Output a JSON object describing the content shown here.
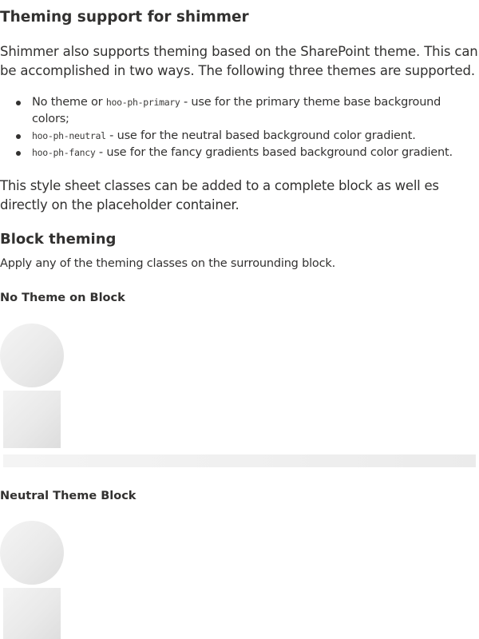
{
  "section": {
    "title": "Theming support for shimmer",
    "intro": "Shimmer also supports theming based on the SharePoint theme. This can be accomplished in two ways. The following three themes are supported.",
    "themes": [
      {
        "prefix": "No theme or ",
        "code": "hoo-ph-primary",
        "description": " - use for the primary theme base background colors;"
      },
      {
        "prefix": "",
        "code": "hoo-ph-neutral",
        "description": " - use for the neutral based background color gradient."
      },
      {
        "prefix": "",
        "code": "hoo-ph-fancy",
        "description": " - use for the fancy gradients based background color gradient."
      }
    ],
    "usage": "This style sheet classes can be added to a complete block as well es directly on the placeholder container."
  },
  "block_theming": {
    "title": "Block theming",
    "description": "Apply any of the theming classes on the surrounding block.",
    "demos": [
      {
        "title": "No Theme on Block"
      },
      {
        "title": "Neutral Theme Block"
      }
    ]
  }
}
